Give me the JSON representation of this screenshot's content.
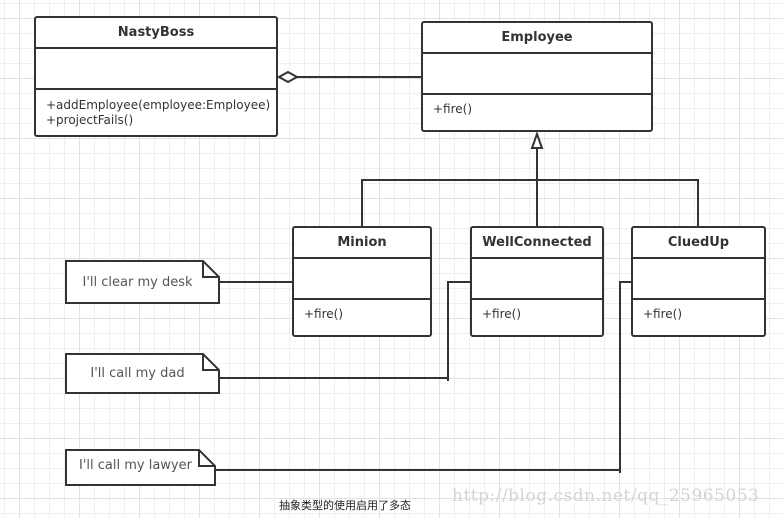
{
  "classes": {
    "nastyboss": {
      "name": "NastyBoss",
      "operations": [
        "+addEmployee(employee:Employee)",
        "+projectFails()"
      ]
    },
    "employee": {
      "name": "Employee",
      "operations": [
        "+fire()"
      ]
    },
    "minion": {
      "name": "Minion",
      "operations": [
        "+fire()"
      ]
    },
    "wellconnected": {
      "name": "WellConnected",
      "operations": [
        "+fire()"
      ]
    },
    "cluedup": {
      "name": "CluedUp",
      "operations": [
        "+fire()"
      ]
    }
  },
  "notes": {
    "minion_note": "I'll clear my desk",
    "wellconnected_note": "I'll call my dad",
    "cluedup_note": "I'll call my lawyer"
  },
  "relations": [
    {
      "type": "aggregation",
      "from": "NastyBoss",
      "to": "Employee"
    },
    {
      "type": "generalization",
      "from": "Minion",
      "to": "Employee"
    },
    {
      "type": "generalization",
      "from": "WellConnected",
      "to": "Employee"
    },
    {
      "type": "generalization",
      "from": "CluedUp",
      "to": "Employee"
    }
  ],
  "caption": "抽象类型的使用启用了多态",
  "watermark": "http://blog.csdn.net/qq_25965053"
}
